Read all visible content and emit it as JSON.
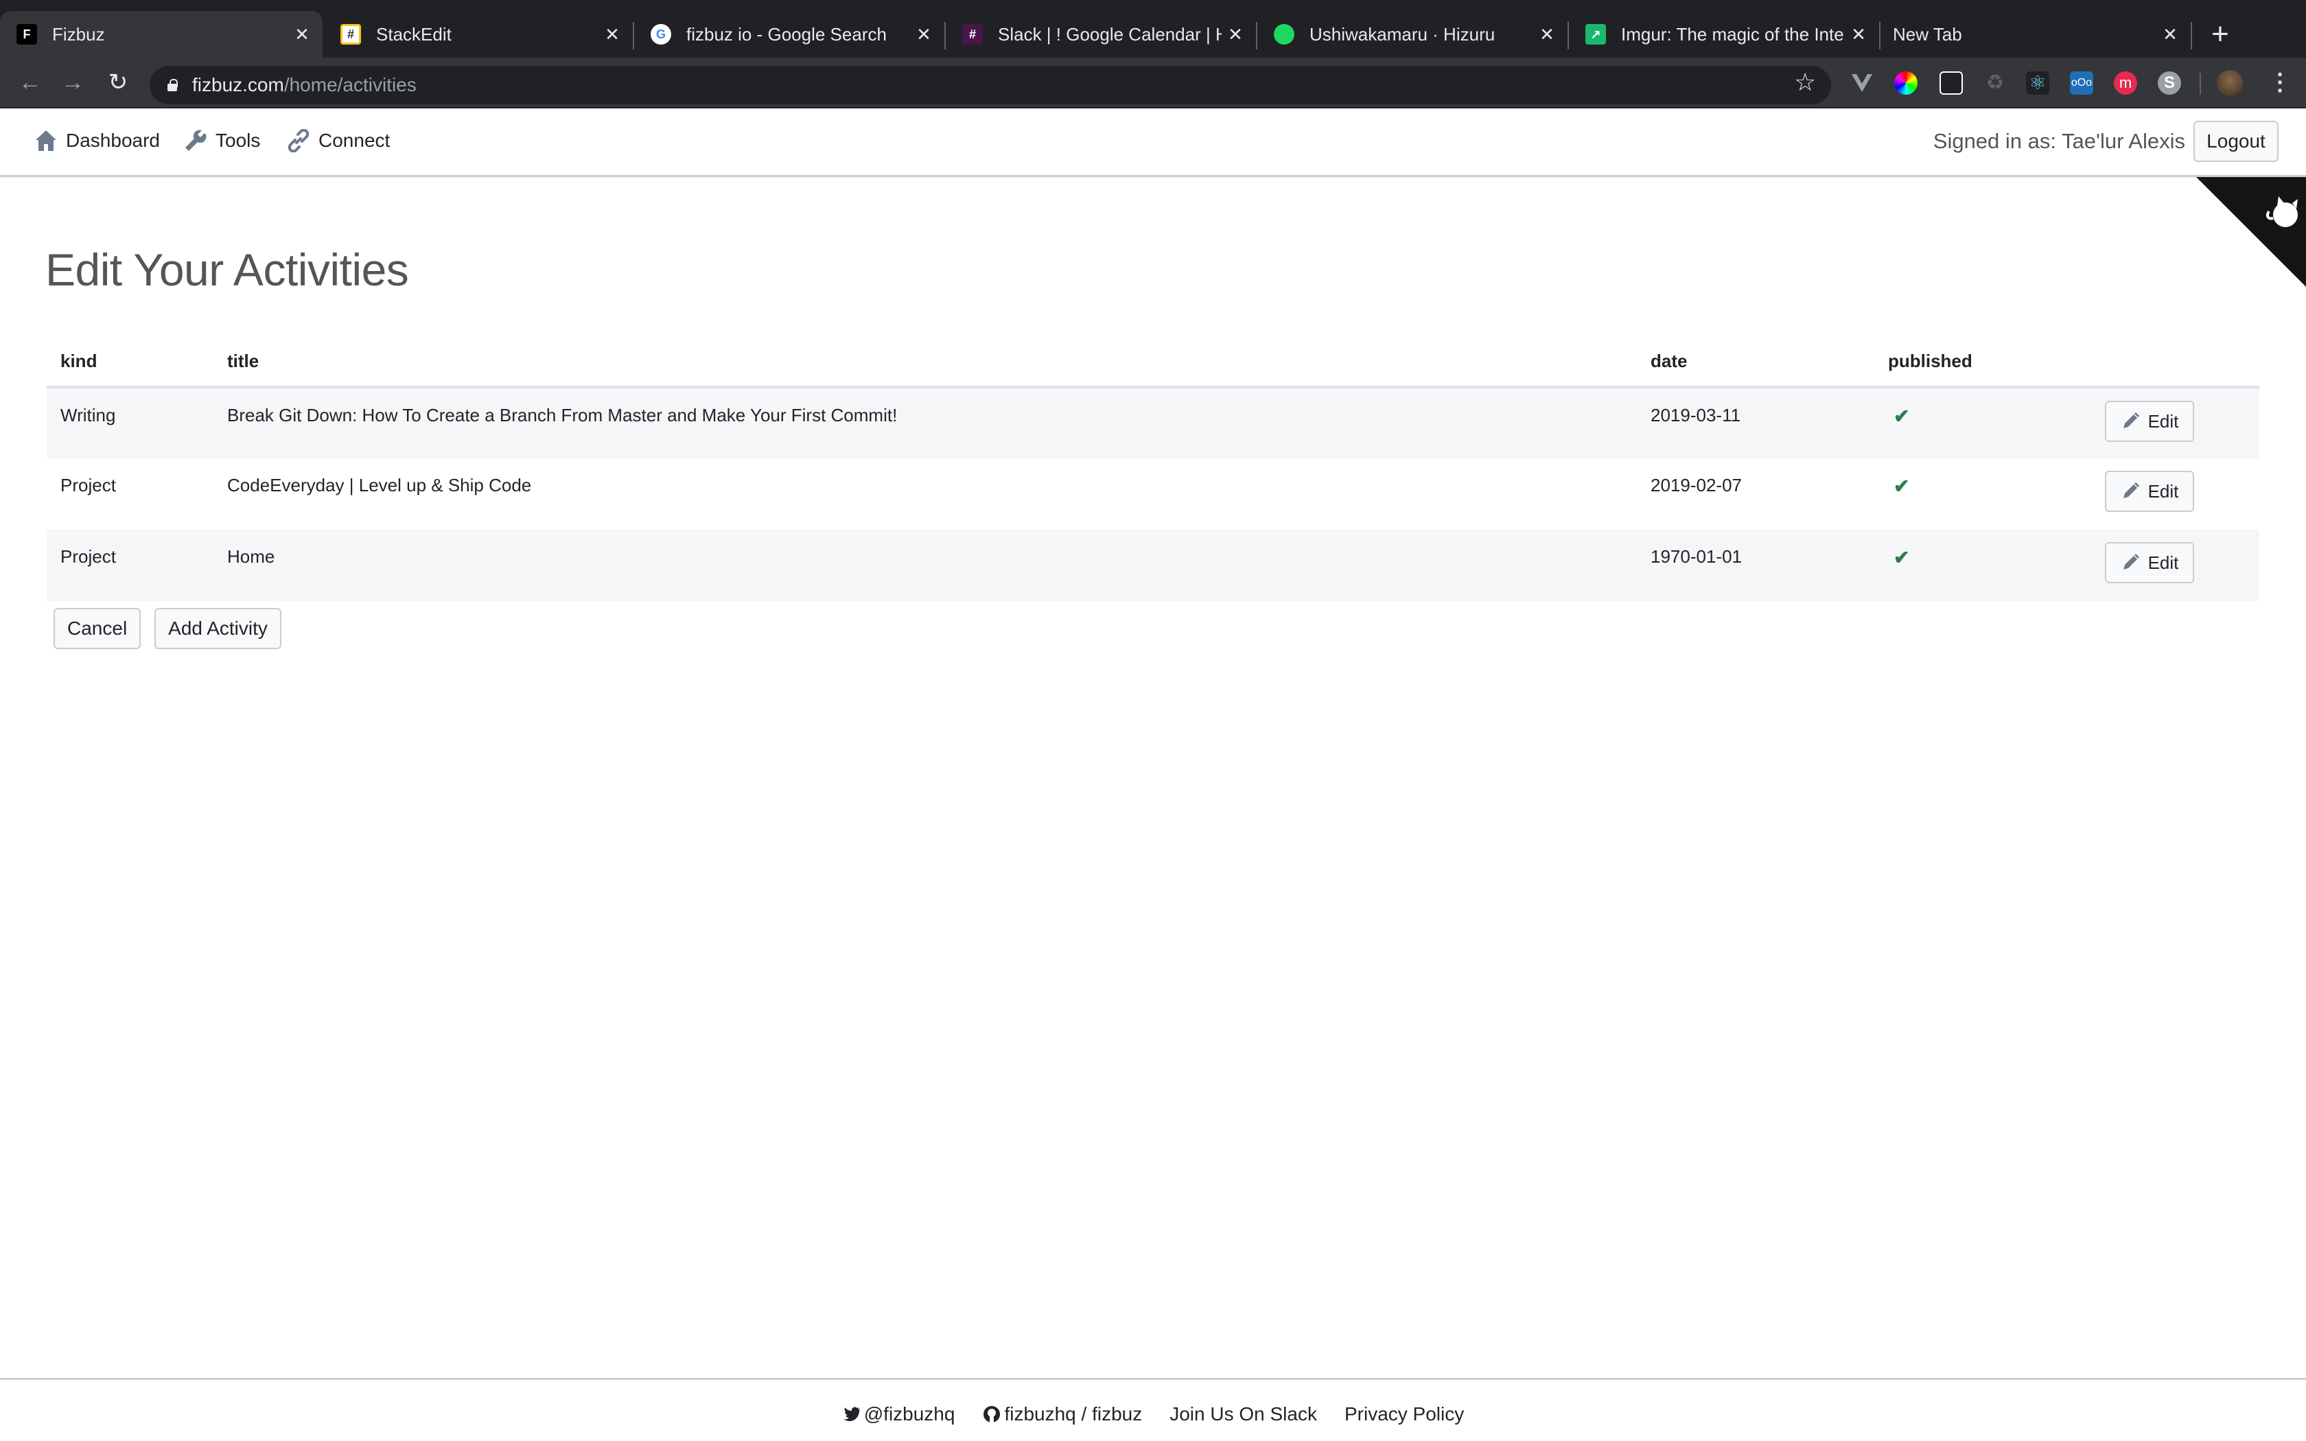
{
  "browser": {
    "tabs": [
      {
        "label": "Fizbuz",
        "icon": "fizbuz-favicon",
        "active": true
      },
      {
        "label": "StackEdit",
        "icon": "stackedit-favicon",
        "active": false
      },
      {
        "label": "fizbuz io - Google Search",
        "icon": "google-favicon",
        "active": false
      },
      {
        "label": "Slack | ! Google Calendar | Ho",
        "icon": "slack-favicon",
        "active": false
      },
      {
        "label": "Ushiwakamaru · Hizuru",
        "icon": "spotify-favicon",
        "active": false
      },
      {
        "label": "Imgur: The magic of the Intern",
        "icon": "imgur-favicon",
        "active": false
      },
      {
        "label": "New Tab",
        "icon": "",
        "active": false
      }
    ],
    "close_glyph": "✕",
    "new_tab_glyph": "+",
    "url_domain": "fizbuz.com",
    "url_path": "/home/activities",
    "extensions": [
      "vue-devtools",
      "color-picker",
      "stylus",
      "recycle",
      "react-devtools",
      "nextcloud",
      "monica",
      "skype"
    ]
  },
  "nav": {
    "links": [
      {
        "label": "Dashboard",
        "icon": "home-icon"
      },
      {
        "label": "Tools",
        "icon": "wrench-icon"
      },
      {
        "label": "Connect",
        "icon": "link-icon"
      }
    ],
    "signed_in_text": "Signed in as: Tae'lur Alexis",
    "logout_label": "Logout"
  },
  "page": {
    "title": "Edit Your Activities",
    "table": {
      "columns": [
        "kind",
        "title",
        "date",
        "published",
        ""
      ],
      "rows": [
        {
          "kind": "Writing",
          "title": "Break Git Down: How To Create a Branch From Master and Make Your First Commit!",
          "date": "2019-03-11",
          "published": true,
          "edit_label": "Edit"
        },
        {
          "kind": "Project",
          "title": "CodeEveryday | Level up & Ship Code",
          "date": "2019-02-07",
          "published": true,
          "edit_label": "Edit"
        },
        {
          "kind": "Project",
          "title": "Home",
          "date": "1970-01-01",
          "published": true,
          "edit_label": "Edit"
        }
      ]
    },
    "published_glyph": "✔",
    "cancel_label": "Cancel",
    "add_label": "Add Activity"
  },
  "footer": {
    "twitter": "@fizbuzhq",
    "github": "fizbuzhq / fizbuz",
    "slack": "Join Us On Slack",
    "privacy": "Privacy Policy"
  },
  "colors": {
    "published_check": "#2e7d4f",
    "icon_gray": "#6c7a89",
    "chrome_dark": "#202124",
    "chrome_toolbar": "#35363a"
  }
}
